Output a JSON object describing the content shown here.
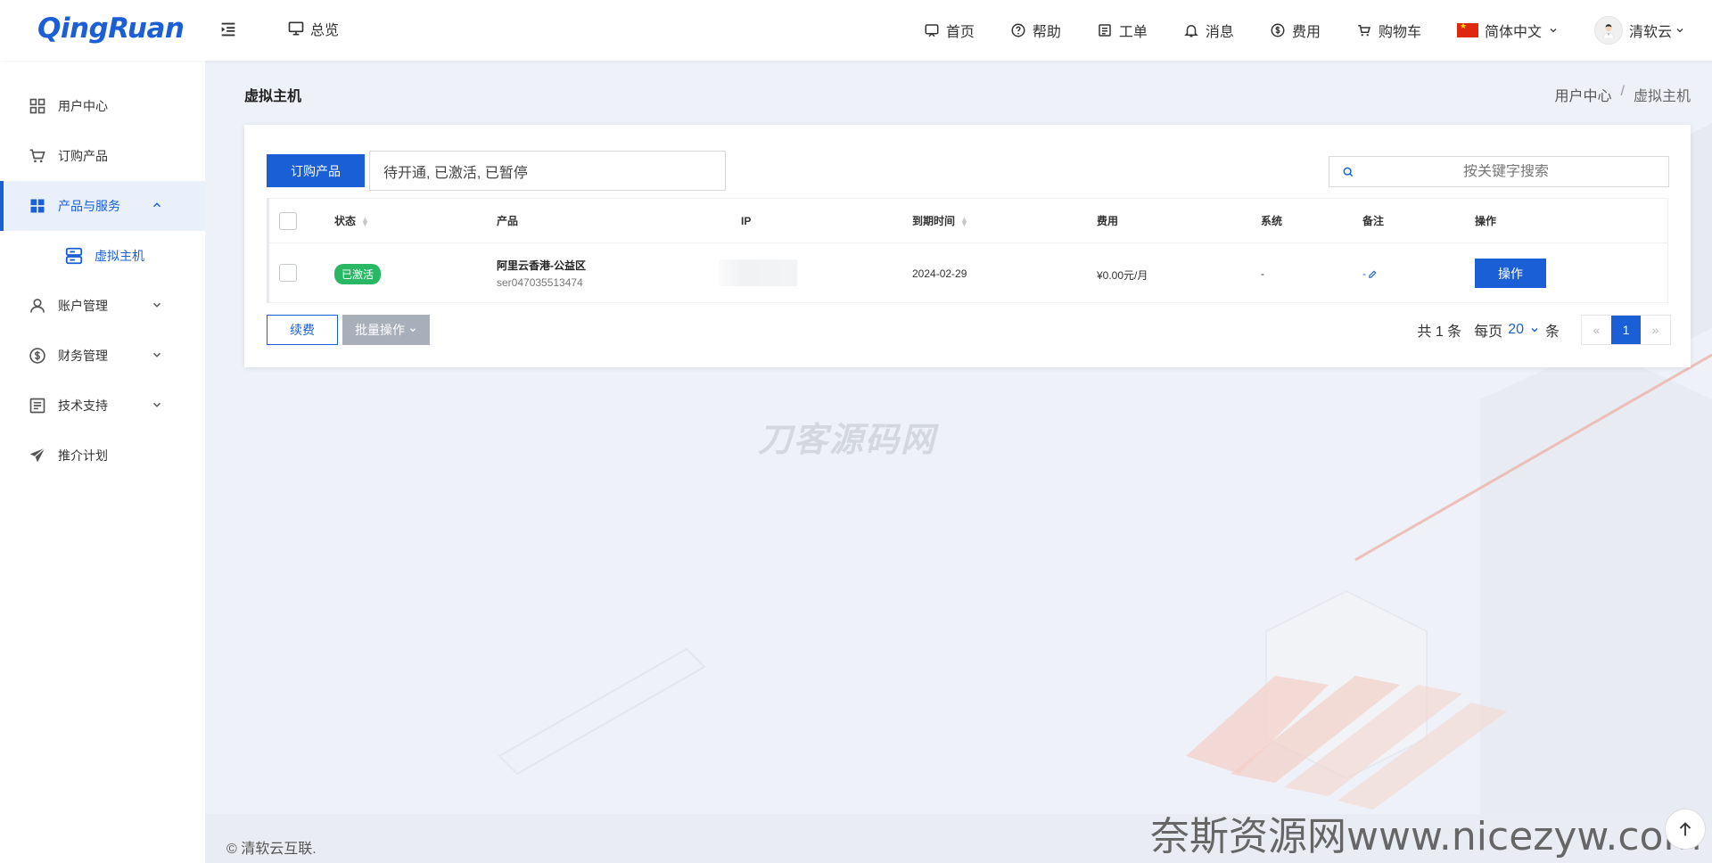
{
  "brand": {
    "logo": "QingRuan"
  },
  "header": {
    "overview_label": "总览",
    "nav": [
      {
        "label": "首页"
      },
      {
        "label": "帮助"
      },
      {
        "label": "工单"
      },
      {
        "label": "消息"
      },
      {
        "label": "费用"
      },
      {
        "label": "购物车"
      }
    ],
    "language": "简体中文",
    "user": "清软云"
  },
  "sidebar": {
    "items": [
      {
        "label": "用户中心"
      },
      {
        "label": "订购产品"
      },
      {
        "label": "产品与服务"
      },
      {
        "label": "账户管理"
      },
      {
        "label": "财务管理"
      },
      {
        "label": "技术支持"
      },
      {
        "label": "推介计划"
      }
    ],
    "sub_items": [
      {
        "label": "虚拟主机"
      }
    ]
  },
  "page": {
    "title": "虚拟主机",
    "breadcrumb": [
      "用户中心",
      "/",
      "虚拟主机"
    ]
  },
  "toolbar": {
    "order_button": "订购产品",
    "status_filter": "待开通, 已激活, 已暂停",
    "search_placeholder": "按关键字搜索"
  },
  "table": {
    "columns": [
      "状态",
      "产品",
      "IP",
      "到期时间",
      "费用",
      "系统",
      "备注",
      "操作"
    ],
    "rows": [
      {
        "status": "已激活",
        "product_name": "阿里云香港-公益区",
        "product_id": "ser047035513474",
        "ip": "",
        "expire": "2024-02-29",
        "fee": "¥0.00元/月",
        "os": "-",
        "note": "-",
        "action": "操作"
      }
    ]
  },
  "bottom_bar": {
    "renew_button": "续费",
    "batch_button": "批量操作",
    "total_text": "共 1 条",
    "per_page_label": "每页",
    "per_page_value": "20",
    "per_page_unit": "条",
    "prev": "«",
    "current_page": "1",
    "next": "»"
  },
  "footer": {
    "copyright": "© 清软云互联."
  },
  "watermarks": {
    "center": "刀客源码网",
    "corner": "奈斯资源网www.nicezyw.com"
  },
  "colors": {
    "primary": "#1a5fd6",
    "success": "#28b864",
    "disabled": "#a9aebb",
    "background": "#eef1f8"
  }
}
